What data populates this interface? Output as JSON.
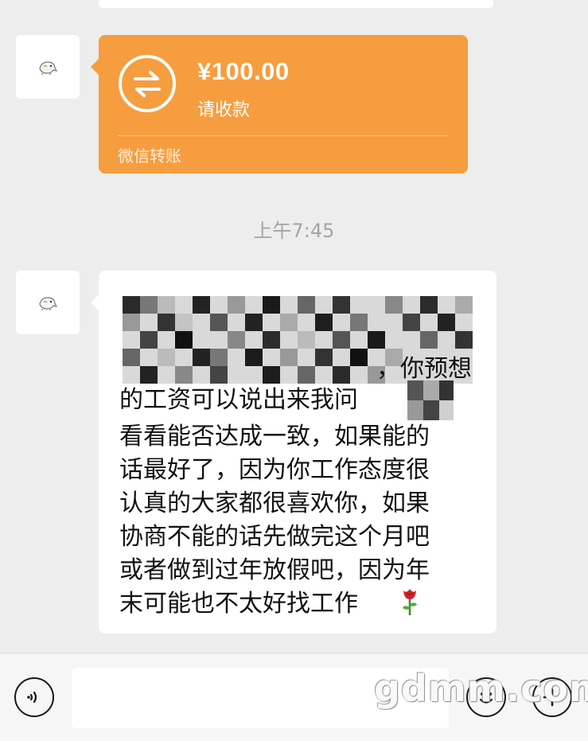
{
  "transfer": {
    "amount": "¥100.00",
    "status": "请收款",
    "footer": "微信转账",
    "color": "#f69d3f",
    "icon": "transfer-arrows-icon"
  },
  "timestamp": "上午7:45",
  "message": {
    "lines": [
      "，你预想",
      "的工资可以说出来我问",
      "看看能否达成一致，如果能的",
      "话最好了，因为你工作态度很",
      "认真的大家都很喜欢你，如果",
      "协商不能的话先做完这个月吧",
      "或者做到过年放假吧，因为年",
      "末可能也不太好找工作"
    ],
    "emoji": "rose-emoji"
  },
  "input_bar": {
    "voice_icon": "voice-icon",
    "emoji_icon": "emoji-icon",
    "plus_icon": "plus-icon",
    "input_value": ""
  },
  "watermark": "gdmm.com"
}
